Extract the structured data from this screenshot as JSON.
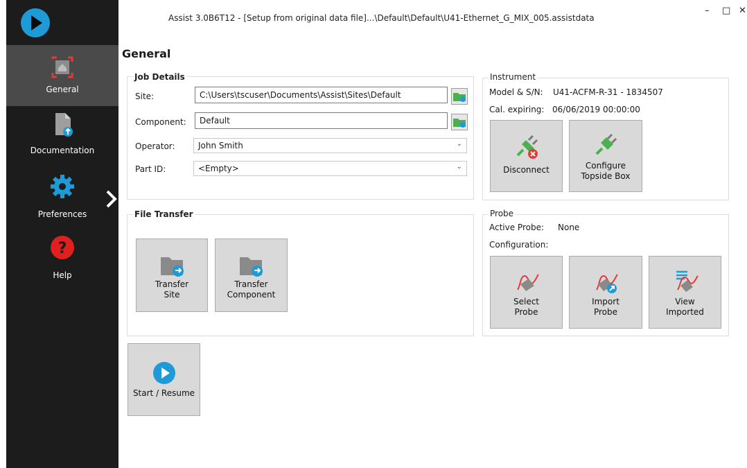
{
  "window": {
    "title": "Assist 3.0B6T12 - [Setup from original data file]...\\Default\\Default\\U41-Ethernet_G_MIX_005.assistdata",
    "minimize": "–",
    "maximize": "□",
    "close": "✕"
  },
  "sidebar": {
    "items": [
      {
        "label": "General",
        "icon": "home-icon",
        "active": true
      },
      {
        "label": "Documentation",
        "icon": "document-icon",
        "active": false
      },
      {
        "label": "Preferences",
        "icon": "gear-icon",
        "active": false
      },
      {
        "label": "Help",
        "icon": "help-icon",
        "active": false
      }
    ]
  },
  "page": {
    "title": "General"
  },
  "job_details": {
    "title": "Job Details",
    "site_label": "Site:",
    "site_value": "C:\\Users\\tscuser\\Documents\\Assist\\Sites\\Default",
    "component_label": "Component:",
    "component_value": "Default",
    "operator_label": "Operator:",
    "operator_value": "John Smith",
    "partid_label": "Part ID:",
    "partid_value": "<Empty>"
  },
  "instrument": {
    "title": "Instrument",
    "model_label": "Model & S/N:",
    "model_value": "U41-ACFM-R-31 - 1834507",
    "cal_label": "Cal. expiring:",
    "cal_value": "06/06/2019 00:00:00",
    "disconnect": "Disconnect",
    "configure_line1": "Configure",
    "configure_line2": "Topside Box"
  },
  "file_transfer": {
    "title": "File Transfer",
    "site_line1": "Transfer",
    "site_line2": "Site",
    "component_line1": "Transfer",
    "component_line2": "Component"
  },
  "probe": {
    "title": "Probe",
    "active_label": "Active Probe:",
    "active_value": "None",
    "config_label": "Configuration:",
    "select_line1": "Select",
    "select_line2": "Probe",
    "import_line1": "Import",
    "import_line2": "Probe",
    "view_line1": "View",
    "view_line2": "Imported"
  },
  "start": {
    "label": "Start / Resume"
  },
  "colors": {
    "sidebar_bg": "#1c1c1c",
    "sidebar_active": "#4a4a4a",
    "accent_blue": "#1e9bd7",
    "help_red": "#e0201f",
    "tile_bg": "#d9d9d9",
    "folder_green": "#4caf50"
  }
}
